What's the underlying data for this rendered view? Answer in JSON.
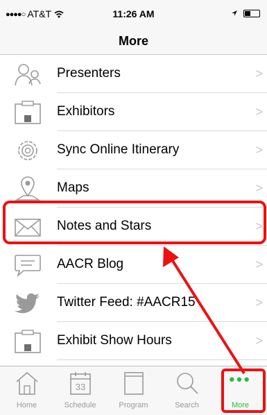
{
  "status_bar": {
    "carrier": "AT&T",
    "signal_dots": "●●●●○",
    "time": "11:26 AM"
  },
  "nav": {
    "title": "More"
  },
  "items": [
    {
      "label": "Presenters",
      "icon": "presenters-icon"
    },
    {
      "label": "Exhibitors",
      "icon": "exhibitors-icon"
    },
    {
      "label": "Sync Online Itinerary",
      "icon": "gear-icon"
    },
    {
      "label": "Maps",
      "icon": "map-pin-icon"
    },
    {
      "label": "Notes and Stars",
      "icon": "envelope-icon"
    },
    {
      "label": "AACR Blog",
      "icon": "speech-bubble-icon"
    },
    {
      "label": "Twitter Feed: #AACR15",
      "icon": "twitter-icon"
    },
    {
      "label": "Exhibit Show Hours",
      "icon": "exhibit-hours-icon"
    }
  ],
  "chevron": ">",
  "tabs": [
    {
      "label": "Home",
      "icon": "home-icon"
    },
    {
      "label": "Schedule",
      "icon": "calendar-icon",
      "calendar_day": "33"
    },
    {
      "label": "Program",
      "icon": "program-icon"
    },
    {
      "label": "Search",
      "icon": "search-icon"
    },
    {
      "label": "More",
      "icon": "more-dots-icon",
      "dots": "•••",
      "active": true
    }
  ],
  "colors": {
    "accent": "#2dbb3b",
    "annotation": "#ee1111",
    "icon_gray": "#9a9a9a"
  }
}
